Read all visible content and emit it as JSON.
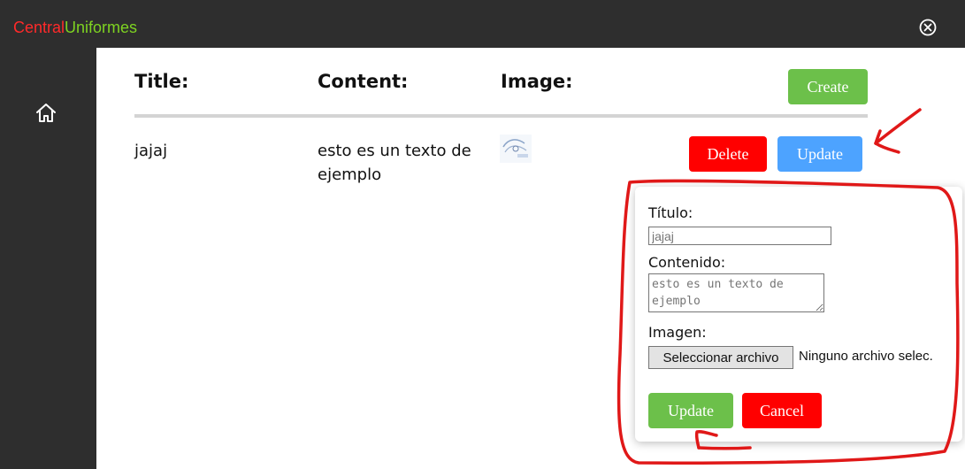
{
  "brand": {
    "part1": "Central",
    "part2": "Uniformes"
  },
  "table": {
    "headers": {
      "title": "Title:",
      "content": "Content:",
      "image": "Image:"
    },
    "create_label": "Create",
    "row": {
      "title": "jajaj",
      "content": "esto es un texto de ejemplo",
      "delete_label": "Delete",
      "update_label": "Update"
    }
  },
  "edit_form": {
    "title_label": "Título:",
    "title_value": "jajaj",
    "content_label": "Contenido:",
    "content_value": "esto es un texto de ejemplo",
    "image_label": "Imagen:",
    "file_button_label": "Seleccionar archivo",
    "file_status": "Ninguno archivo selec.",
    "update_label": "Update",
    "cancel_label": "Cancel"
  },
  "icons": {
    "close": "close-circle-icon",
    "home": "home-icon"
  },
  "colors": {
    "brand_red": "#ff2a2a",
    "brand_green": "#7ed321",
    "create_green": "#6cc04a",
    "delete_red": "#ff0000",
    "update_blue": "#4da3ff"
  }
}
